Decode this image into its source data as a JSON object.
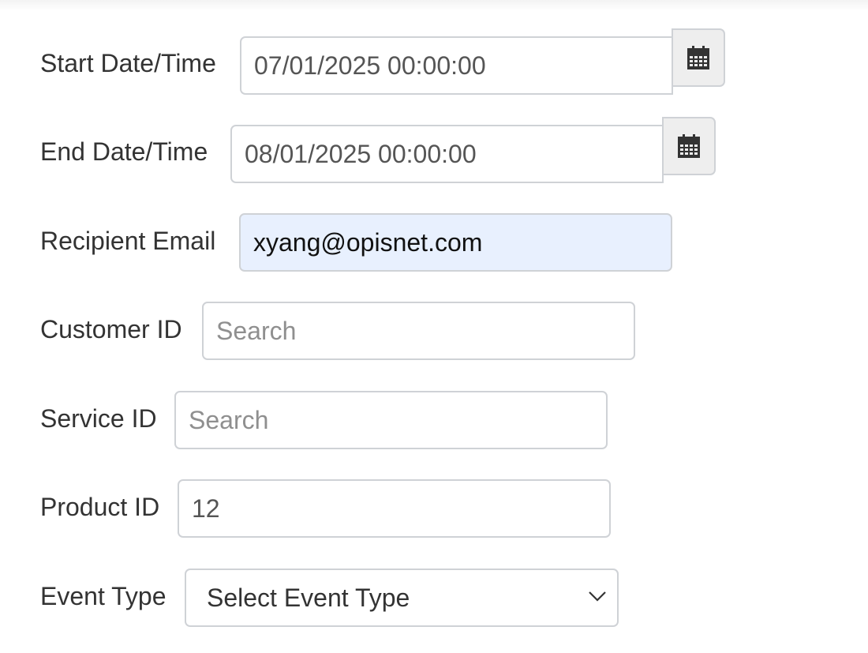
{
  "form": {
    "start_datetime": {
      "label": "Start Date/Time",
      "value": "07/01/2025 00:00:00",
      "button_icon": "calendar-icon"
    },
    "end_datetime": {
      "label": "End Date/Time",
      "value": "08/01/2025 00:00:00",
      "button_icon": "calendar-icon"
    },
    "recipient_email": {
      "label": "Recipient Email",
      "value": "xyang@opisnet.com"
    },
    "customer_id": {
      "label": "Customer ID",
      "value": "",
      "placeholder": "Search"
    },
    "service_id": {
      "label": "Service ID",
      "value": "",
      "placeholder": "Search"
    },
    "product_id": {
      "label": "Product ID",
      "value": "12"
    },
    "event_type": {
      "label": "Event Type",
      "selected": "Select Event Type",
      "icon": "chevron-down-icon"
    }
  },
  "colors": {
    "autofill_background": "#e8f0fe",
    "input_border": "#cfd2d6",
    "addon_background": "#eeeeee",
    "label_text": "#333333",
    "placeholder_text": "#8f8f8f"
  }
}
